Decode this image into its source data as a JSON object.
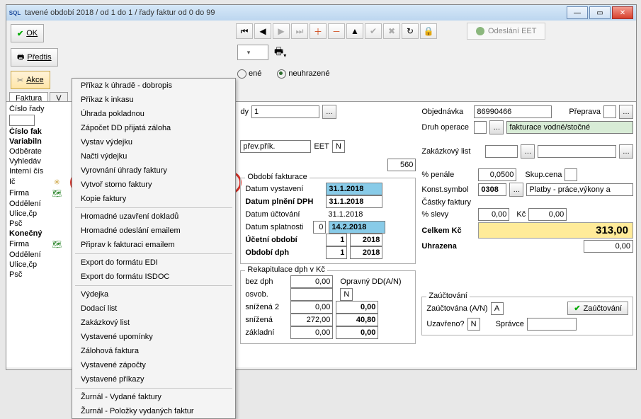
{
  "titlebar": {
    "title": "tavené období 2018 / od 1 do 1 / řady faktur od 0 do 99",
    "app_icon": "SQL"
  },
  "toolbar": {
    "ok": "OK",
    "predtis": "Předtis",
    "akce": "Akce"
  },
  "navbar": {
    "eet": "Odeslání EET"
  },
  "row3": {
    "radio_ene": "ené",
    "radio_neuhr": "neuhrazené"
  },
  "tabs": {
    "t1": "Faktura",
    "t2": "V"
  },
  "left": {
    "l0": "Číslo řady",
    "l1": "Číslo fak",
    "l2": "Variabiln",
    "l3": "Odběrate",
    "l4": "Vyhledáv",
    "l5": "Interní čís",
    "l6": "Ič",
    "l7": "Firma",
    "l8": "Oddělení",
    "l9": "Ulice,čp",
    "l10": "Psč",
    "l11": "Konečný",
    "l12": "Firma",
    "l13": "Oddělení",
    "l14": "Ulice,čp",
    "l15": "Psč"
  },
  "menu": {
    "m0": "Příkaz k úhradě - dobropis",
    "m1": "Příkaz k inkasu",
    "m2": "Úhrada pokladnou",
    "m3": "Zápočet DD přijatá záloha",
    "m4": "Vystav výdejku",
    "m5": "Načti výdejku",
    "m6": "Vyrovnání úhrady faktury",
    "m7": "Vytvoř storno faktury",
    "m8": "Kopie faktury",
    "m9": "Hromadné uzavření dokladů",
    "m10": "Hromadné odeslání emailem",
    "m11": "Připrav k fakturaci emailem",
    "m12": "Export do formátu EDI",
    "m13": "Export do formátu ISDOC",
    "m14": "Výdejka",
    "m15": "Dodací list",
    "m16": "Zakázkový list",
    "m17": "Vystavené upomínky",
    "m18": "Zálohová faktura",
    "m19": "Vystavené zápočty",
    "m20": "Vystavené příkazy",
    "m21": "Žurnál - Vydané faktury",
    "m22": "Žurnál - Položky vydaných faktur"
  },
  "mid": {
    "dy": "dy",
    "dy_val": "1",
    "prev": "přev.přík.",
    "eet": "EET",
    "n": "N",
    "val560": "560",
    "obdobi_fakt": "Období fakturace",
    "datum_vyst": "Datum vystavení",
    "datum_plneni": "Datum plnění DPH",
    "datum_uctovani": "Datum účtování",
    "datum_splat": "Datum splatnosti",
    "ucetni_obdobi": "Účetní období",
    "obdobi_dph": "Období dph",
    "d1": "31.1.2018",
    "d2": "31.1.2018",
    "d3": "31.1.2018",
    "d4": "14.2.2018",
    "splat_days": "0",
    "uo_m": "1",
    "uo_y": "2018",
    "od_m": "1",
    "od_y": "2018",
    "rekap": "Rekapitulace dph v Kč",
    "bezdph": "bez dph",
    "osvob": "osvob.",
    "sniz2": "snížená 2",
    "sniz": "snížená",
    "zakl": "základní",
    "v_bez": "0,00",
    "v_osv": "",
    "v_s2a": "0,00",
    "v_s2b": "0,00",
    "v_sa": "272,00",
    "v_sb": "40,80",
    "v_za": "0,00",
    "v_zb": "0,00",
    "opravny": "Opravný DD(A/N)",
    "opravny_v": "N"
  },
  "right": {
    "objednavka": "Objednávka",
    "obj_v": "86990466",
    "preprava": "Přeprava",
    "druh": "Druh operace",
    "druh_v": "fakturace vodné/stočné",
    "zaklist": "Zakázkový list",
    "penale": "% penále",
    "penale_v": "0,0500",
    "skup": "Skup.cena",
    "konst": "Konst.symbol",
    "konst_v": "0308",
    "platby": "Platby - práce,výkony a",
    "castky": "Částky faktury",
    "slevy": "% slevy",
    "slevy_v": "0,00",
    "kc": "Kč",
    "kc_v": "0,00",
    "celkem": "Celkem Kč",
    "celkem_v": "313,00",
    "uhrazena": "Uhrazena",
    "uhrazena_v": "0,00",
    "zauct": "Zaúčtování",
    "zauct_an": "Zaúčtována (A/N)",
    "zauct_v": "A",
    "zauct_btn": "Zaúčtování",
    "uzav": "Uzavřeno?",
    "uzav_v": "N",
    "spravce": "Správce"
  }
}
